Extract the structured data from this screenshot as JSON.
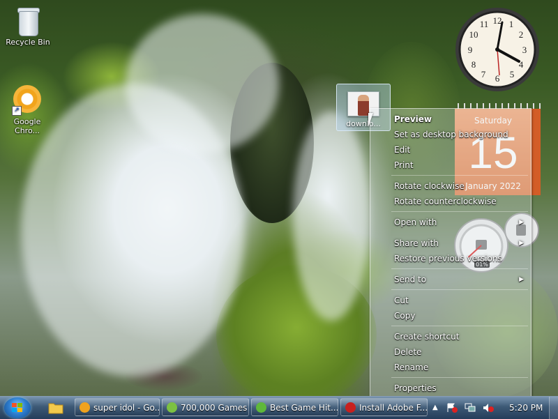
{
  "desktop": {
    "icons": [
      {
        "label": "Recycle Bin"
      },
      {
        "label": "Google Chro..."
      }
    ],
    "selected_file": {
      "label": "downlo..."
    }
  },
  "gadgets": {
    "calendar": {
      "weekday": "Saturday",
      "day": "15",
      "month_year": "January 2022"
    },
    "cpu_meter": {
      "percent_label": "01%",
      "cpu_fraction": 0.01
    }
  },
  "context_menu": {
    "items": [
      {
        "label": "Preview",
        "bold": true
      },
      {
        "label": "Set as desktop background"
      },
      {
        "label": "Edit"
      },
      {
        "label": "Print"
      },
      {
        "label": "Rotate clockwise"
      },
      {
        "label": "Rotate counterclockwise"
      },
      {
        "label": "Open with",
        "submenu": true
      },
      {
        "label": "Share with",
        "submenu": true
      },
      {
        "label": "Restore previous versions"
      },
      {
        "label": "Send to",
        "submenu": true
      },
      {
        "label": "Cut"
      },
      {
        "label": "Copy"
      },
      {
        "label": "Create shortcut"
      },
      {
        "label": "Delete"
      },
      {
        "label": "Rename"
      },
      {
        "label": "Properties"
      }
    ]
  },
  "taskbar": {
    "buttons": [
      {
        "label": "super idol - Go...",
        "icon": "chrome-icon",
        "color": "#f0a21e"
      },
      {
        "label": "700,000 Games",
        "icon": "games-icon",
        "color": "#7cc142"
      },
      {
        "label": "Best Game Hit...",
        "icon": "download-icon",
        "color": "#5fb83a"
      },
      {
        "label": "Install Adobe F...",
        "icon": "adobe-flash-icon",
        "color": "#c8201e"
      }
    ],
    "clock": "5:20 PM"
  },
  "colors": {
    "calendar_orange": "#e07b44",
    "taskbar_blue": "#325070"
  }
}
